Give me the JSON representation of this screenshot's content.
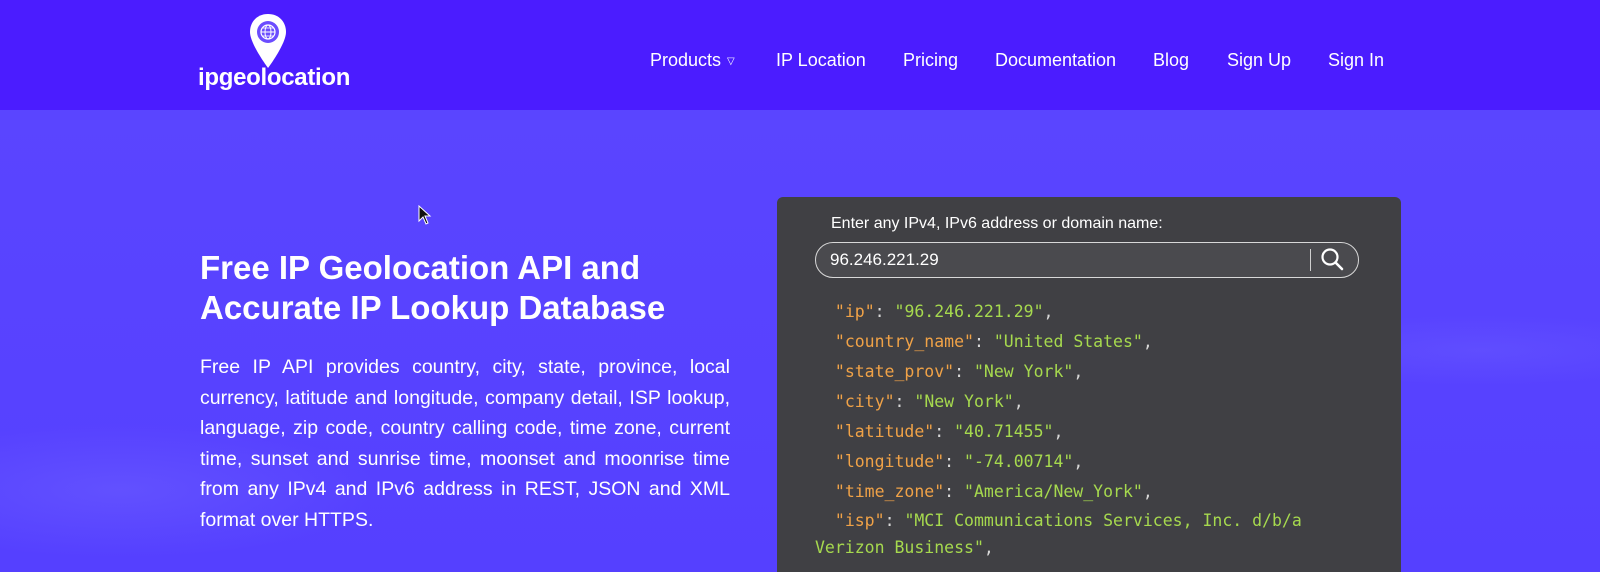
{
  "brand": {
    "name": "ipgeolocation",
    "icon": "globe-pin-icon"
  },
  "nav": {
    "items": [
      {
        "label": "Products",
        "has_dropdown": true
      },
      {
        "label": "IP Location"
      },
      {
        "label": "Pricing"
      },
      {
        "label": "Documentation"
      },
      {
        "label": "Blog"
      },
      {
        "label": "Sign Up"
      },
      {
        "label": "Sign In"
      }
    ]
  },
  "hero": {
    "title": "Free IP Geolocation API and Accurate IP Lookup Database",
    "description": "Free IP API provides country, city, state, province, local currency, latitude and longitude, company detail, ISP lookup, language, zip code, country calling code, time zone, current time, sunset and sunrise time, moonset and moonrise time from any IPv4 and IPv6 address in REST, JSON and XML format over HTTPS."
  },
  "lookup": {
    "label": "Enter any IPv4, IPv6 address or domain name:",
    "input_value": "96.246.221.29",
    "search_icon": "search-icon",
    "result": [
      {
        "key": "ip",
        "value": "96.246.221.29"
      },
      {
        "key": "country_name",
        "value": "United States"
      },
      {
        "key": "state_prov",
        "value": "New York"
      },
      {
        "key": "city",
        "value": "New York"
      },
      {
        "key": "latitude",
        "value": "40.71455"
      },
      {
        "key": "longitude",
        "value": "-74.00714"
      },
      {
        "key": "time_zone",
        "value": "America/New_York"
      },
      {
        "key": "isp",
        "value": "MCI Communications Services, Inc. d/b/a Verizon Business"
      }
    ]
  },
  "colors": {
    "header_bg": "#4b1cff",
    "hero_bg": "#5540ff",
    "card_bg": "#404044",
    "json_key": "#f0a247",
    "json_value": "#a6d94e"
  }
}
